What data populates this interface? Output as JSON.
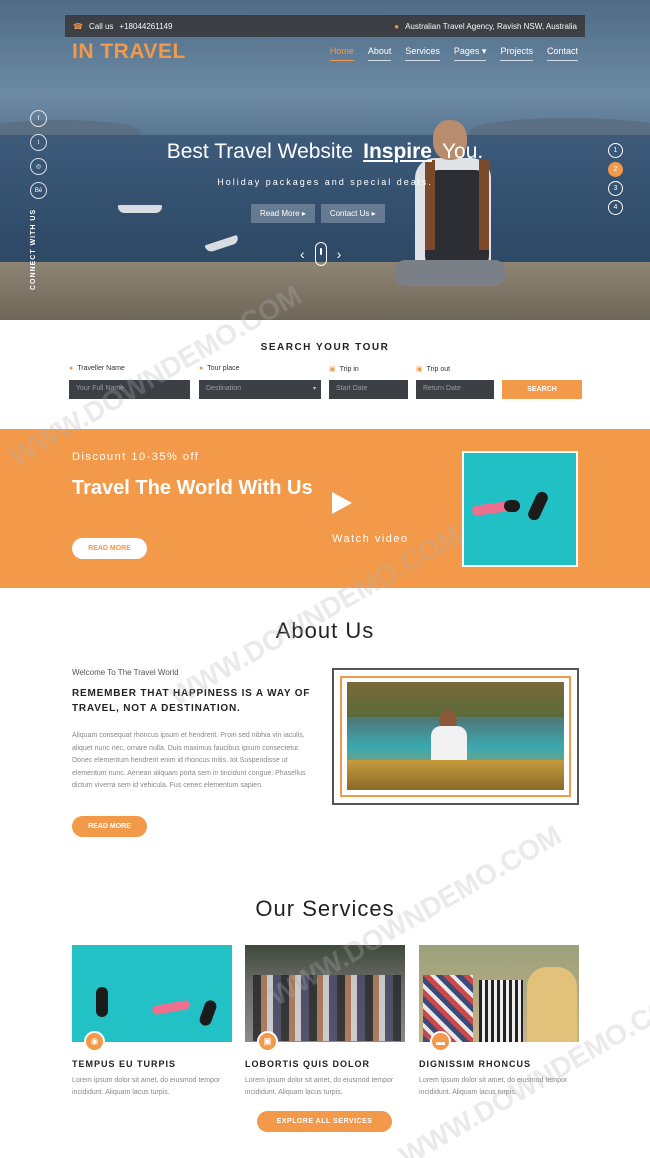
{
  "topbar": {
    "call_label": "Call us",
    "phone": "+18044261149",
    "address": "Australian Travel Agency, Ravish NSW, Australia"
  },
  "brand": {
    "logo": "IN TRAVEL"
  },
  "nav": {
    "home": "Home",
    "about": "About",
    "services": "Services",
    "pages": "Pages",
    "projects": "Projects",
    "contact": "Contact"
  },
  "social": {
    "facebook": "f",
    "twitter": "t",
    "dribbble": "◎",
    "behance": "Bē",
    "connect": "CONNECT WITH US"
  },
  "hero": {
    "title_pre": "Best Travel Website",
    "title_strong": "Inspire",
    "title_post": "You.",
    "subtitle": "Holiday packages and special deals.",
    "read_more": "Read More",
    "contact_us": "Contact Us",
    "slides": [
      "1",
      "2",
      "3",
      "4"
    ],
    "active_slide": "2"
  },
  "search": {
    "title": "SEARCH YOUR TOUR",
    "traveller_label": "Traveller Name",
    "traveller_placeholder": "Your Full Name",
    "place_label": "Tour place",
    "place_value": "Destination",
    "trip_in_label": "Trip in",
    "trip_in_placeholder": "Start Date",
    "trip_out_label": "Trip out",
    "trip_out_placeholder": "Return Date",
    "button": "SEARCH"
  },
  "discount": {
    "tagline": "Discount 10-35% off",
    "headline": "Travel The World With Us",
    "button": "READ MORE",
    "watch": "Watch video"
  },
  "about": {
    "heading": "About Us",
    "welcome": "Welcome To The Travel World",
    "tagline": "REMEMBER THAT HAPPINESS IS A WAY OF TRAVEL, NOT A DESTINATION.",
    "body": "Aliquam consequat rhoncus ipsum et hendrerit. Proin sed nibhia vin iaculis, aliquet nunc nec, ornare nulla. Duis maximus faucibus ipsum consectetur. Donec elementum hendrerit enim id rhoncus mitis. Iot Suspendisse ut elementum nunc. Aenean aliquam porta sem in tincidunt congue. Phasellus dictum viverra sem id vehicula. Fus cenec elementum sapien.",
    "button": "READ MORE"
  },
  "services": {
    "heading": "Our Services",
    "cards": [
      {
        "title": "TEMPUS EU TURPIS",
        "text": "Lorem ipsum dolor sit amet, do eiusmod tempor incididunt. Aliquam lacus turpis."
      },
      {
        "title": "LOBORTIS QUIS DOLOR",
        "text": "Lorem ipsum dolor sit amet, do eiusmod tempor incididunt. Aliquam lacus turpis."
      },
      {
        "title": "DIGNISSIM RHONCUS",
        "text": "Lorem ipsum dolor sit amet, do eiusmod tempor incididunt. Aliquam lacus turpis."
      }
    ],
    "button": "EXPLORE ALL SERVICES"
  },
  "watermark": "WWW.DOWNDEMO.COM",
  "colors": {
    "accent": "#f2994a",
    "dark": "#3c3f44"
  }
}
